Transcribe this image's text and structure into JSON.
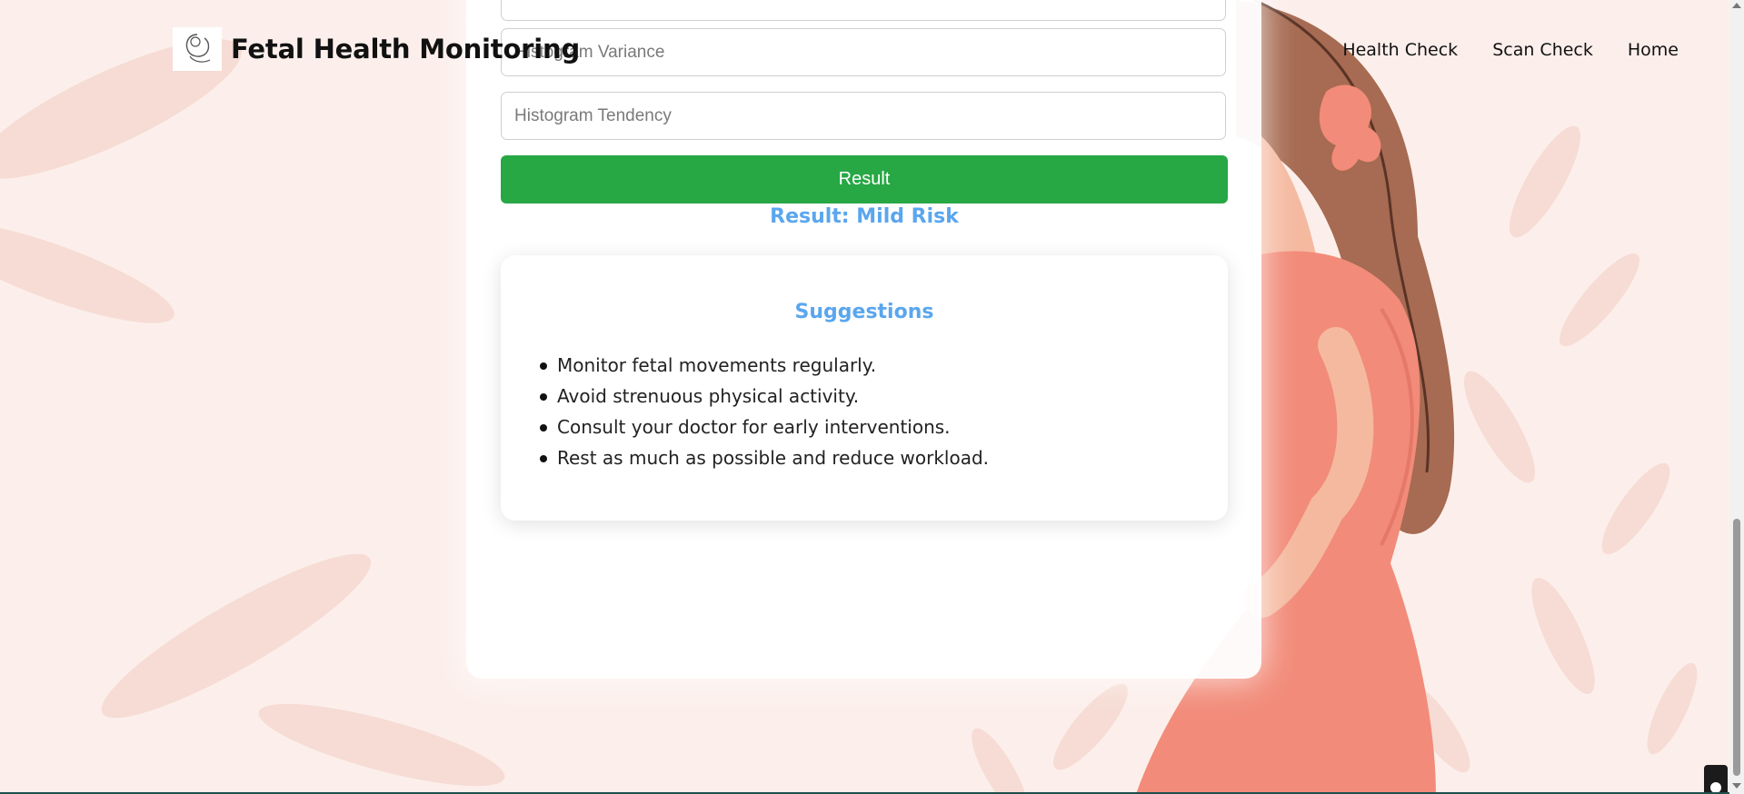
{
  "header": {
    "brand_name": "Fetal Health Monitoring",
    "logo_icon": "fetus-line-art-icon",
    "nav": [
      "Health Check",
      "Scan Check",
      "Home"
    ]
  },
  "form": {
    "top_field_placeholder": "",
    "variance_placeholder": "Histogram Variance",
    "tendency_placeholder": "Histogram Tendency",
    "submit_label": "Result"
  },
  "result": {
    "text": "Result: Mild Risk"
  },
  "suggestions": {
    "title": "Suggestions",
    "items": [
      "Monitor fetal movements regularly.",
      "Avoid strenuous physical activity.",
      "Consult your doctor for early interventions.",
      "Rest as much as possible and reduce workload."
    ]
  },
  "colors": {
    "accent_green": "#28a745",
    "result_blue": "#5aa6ee",
    "background_peach": "#fbeee9",
    "dress_coral": "#f28b79",
    "hair_brown": "#a66b52"
  }
}
